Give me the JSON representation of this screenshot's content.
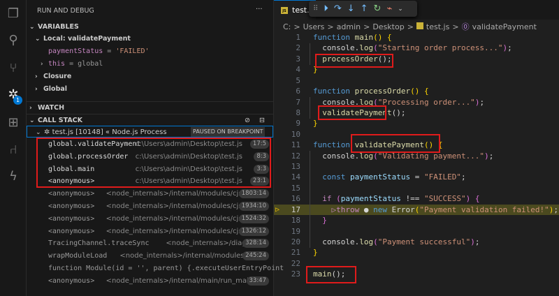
{
  "activity_bar": {
    "items": [
      "explorer-icon",
      "search-icon",
      "source-control-icon",
      "run-debug-icon",
      "extensions-icon",
      "git-graph-icon",
      "lightning-icon"
    ],
    "debug_badge": "1",
    "accent": "#0078d4"
  },
  "sidebar": {
    "title": "RUN AND DEBUG",
    "more": "···",
    "variables": {
      "label": "VARIABLES",
      "scope": "Local: validatePayment",
      "items": [
        {
          "name": "paymentStatus",
          "eq": " = ",
          "value": "'FAILED'"
        },
        {
          "name": "this",
          "eq": " = ",
          "value": "global"
        }
      ],
      "closure": "Closure",
      "global": "Global"
    },
    "watch": {
      "label": "WATCH"
    },
    "call_stack": {
      "label": "CALL STACK",
      "process": "test.js [10148] « Node.js Process",
      "status": "PAUSED ON BREAKPOINT",
      "frames": [
        {
          "fn": "global.validatePayment",
          "path": "c:\\Users\\admin\\Desktop\\test.js",
          "pos": "17:5"
        },
        {
          "fn": "global.processOrder",
          "path": "c:\\Users\\admin\\Desktop\\test.js",
          "pos": "8:3"
        },
        {
          "fn": "global.main",
          "path": "c:\\Users\\admin\\Desktop\\test.js",
          "pos": "3:3"
        },
        {
          "fn": "<anonymous>",
          "path": "c:\\Users\\admin\\Desktop\\test.js",
          "pos": "23:1"
        },
        {
          "fn": "<anonymous>",
          "path": "<node_internals>/internal/modules/cjs/...",
          "pos": "1803:14"
        },
        {
          "fn": "<anonymous>",
          "path": "<node_internals>/internal/modules/cjs/...",
          "pos": "1934:10"
        },
        {
          "fn": "<anonymous>",
          "path": "<node_internals>/internal/modules/cjs/...",
          "pos": "1524:32"
        },
        {
          "fn": "<anonymous>",
          "path": "<node_internals>/internal/modules/cjs/...",
          "pos": "1326:12"
        },
        {
          "fn": "TracingChannel.traceSync",
          "path": "<node_internals>/diagn...",
          "pos": "328:14"
        },
        {
          "fn": "wrapModuleLoad",
          "path": "<node_internals>/internal/modules/c...",
          "pos": "245:24"
        },
        {
          "fn": "function Module(id = '', parent) {.executeUserEntryPoint",
          "path": "",
          "pos": ""
        },
        {
          "fn": "<anonymous>",
          "path": "<node_internals>/internal/main/run_main...",
          "pos": "33:47"
        }
      ]
    }
  },
  "editor": {
    "tab": "test.js",
    "js_icon": "JS",
    "debug_toolbar": [
      "continue-icon",
      "step-over-icon",
      "step-into-icon",
      "step-out-icon",
      "restart-icon",
      "disconnect-icon"
    ],
    "breadcrumbs": [
      "C:",
      ">",
      "Users",
      ">",
      "admin",
      ">",
      "Desktop",
      ">",
      "test.js",
      ">",
      "validatePayment"
    ],
    "current_line": 17,
    "lines": [
      [
        [
          "function ",
          "kw"
        ],
        [
          "main",
          "fnc"
        ],
        [
          "() ",
          "br"
        ],
        [
          "{",
          "br"
        ]
      ],
      [
        [
          "  console.",
          "pl"
        ],
        [
          "log",
          "fnc"
        ],
        [
          "(",
          "br2"
        ],
        [
          "\"Starting order process...\"",
          "str"
        ],
        [
          ")",
          "br2"
        ],
        [
          ";",
          "pl"
        ]
      ],
      [
        [
          "  processOrder",
          "fnc"
        ],
        [
          "();",
          "pl"
        ]
      ],
      [
        [
          "}",
          "br"
        ]
      ],
      [],
      [
        [
          "function ",
          "kw"
        ],
        [
          "processOrder",
          "fnc"
        ],
        [
          "() ",
          "br"
        ],
        [
          "{",
          "br"
        ]
      ],
      [
        [
          "  console.",
          "pl"
        ],
        [
          "log",
          "fnc"
        ],
        [
          "(",
          "br2"
        ],
        [
          "\"Processing order...\"",
          "str"
        ],
        [
          ")",
          "br2"
        ],
        [
          ";",
          "pl"
        ]
      ],
      [
        [
          "  validatePayment",
          "fnc"
        ],
        [
          "();",
          "pl"
        ]
      ],
      [
        [
          "}",
          "br"
        ]
      ],
      [],
      [
        [
          "function ",
          "kw"
        ],
        [
          "validatePayment",
          "fnc"
        ],
        [
          "() ",
          "br"
        ],
        [
          "{",
          "br"
        ]
      ],
      [
        [
          "  console.",
          "pl"
        ],
        [
          "log",
          "fnc"
        ],
        [
          "(",
          "br2"
        ],
        [
          "\"Validating payment...\"",
          "str"
        ],
        [
          ")",
          "br2"
        ],
        [
          ";",
          "pl"
        ]
      ],
      [],
      [
        [
          "  const ",
          "kw"
        ],
        [
          "paymentStatus",
          "var"
        ],
        [
          " = ",
          "pl"
        ],
        [
          "\"FAILED\"",
          "str"
        ],
        [
          ";",
          "pl"
        ]
      ],
      [],
      [
        [
          "  if ",
          "kwc"
        ],
        [
          "(",
          "br2"
        ],
        [
          "paymentStatus",
          "var"
        ],
        [
          " !== ",
          "pl"
        ],
        [
          "\"SUCCESS\"",
          "str"
        ],
        [
          ") ",
          "br2"
        ],
        [
          "{",
          "br2"
        ]
      ],
      [
        [
          "    ▷throw ",
          "kwc"
        ],
        [
          "● ",
          "pl"
        ],
        [
          "new ",
          "kw"
        ],
        [
          "Error",
          "pl"
        ],
        [
          "(",
          "br"
        ],
        [
          "\"Payment validation failed!\"",
          "str"
        ],
        [
          ")",
          "br"
        ],
        [
          ";",
          "pl"
        ]
      ],
      [
        [
          "  }",
          "br2"
        ]
      ],
      [],
      [
        [
          "  console.",
          "pl"
        ],
        [
          "log",
          "fnc"
        ],
        [
          "(",
          "br2"
        ],
        [
          "\"Payment successful\"",
          "str"
        ],
        [
          ")",
          "br2"
        ],
        [
          ";",
          "pl"
        ]
      ],
      [
        [
          "}",
          "br"
        ]
      ],
      [],
      [
        [
          "main",
          "fnc"
        ],
        [
          "();",
          "pl"
        ]
      ]
    ]
  }
}
